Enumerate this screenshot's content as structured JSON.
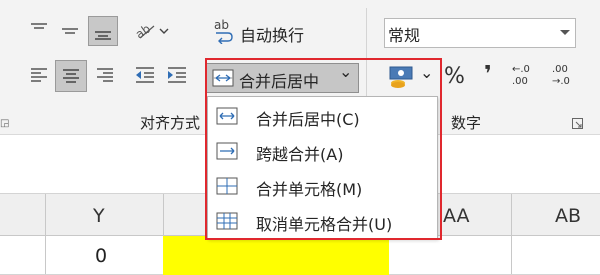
{
  "alignment": {
    "wrap_text_prefix": "ab",
    "wrap_text_label": "自动换行",
    "merge_label": "合并后居中",
    "merge_arrow": "⌄",
    "orientation_arrow": "⌄",
    "group_label": "对齐方式"
  },
  "number": {
    "format_value": "常规",
    "percent": "%",
    "comma": "❜",
    "increase_decimal_top": "←.0",
    "increase_decimal_bottom": ".00",
    "decrease_decimal_top": ".00",
    "decrease_decimal_bottom": "→.0",
    "group_label": "数字",
    "currency_arrow": "⌄"
  },
  "merge_menu": [
    {
      "label": "合并后居中(C)",
      "icon": "merge-center-icon"
    },
    {
      "label": "跨越合并(A)",
      "icon": "merge-across-icon"
    },
    {
      "label": "合并单元格(M)",
      "icon": "merge-cells-icon"
    },
    {
      "label": "取消单元格合并(U)",
      "icon": "unmerge-cells-icon"
    }
  ],
  "columns": [
    "Y",
    "AA",
    "AB"
  ],
  "cells": {
    "y_row1": "0"
  },
  "colors": {
    "highlight": "#ffff00",
    "annotation": "#e0282e"
  }
}
